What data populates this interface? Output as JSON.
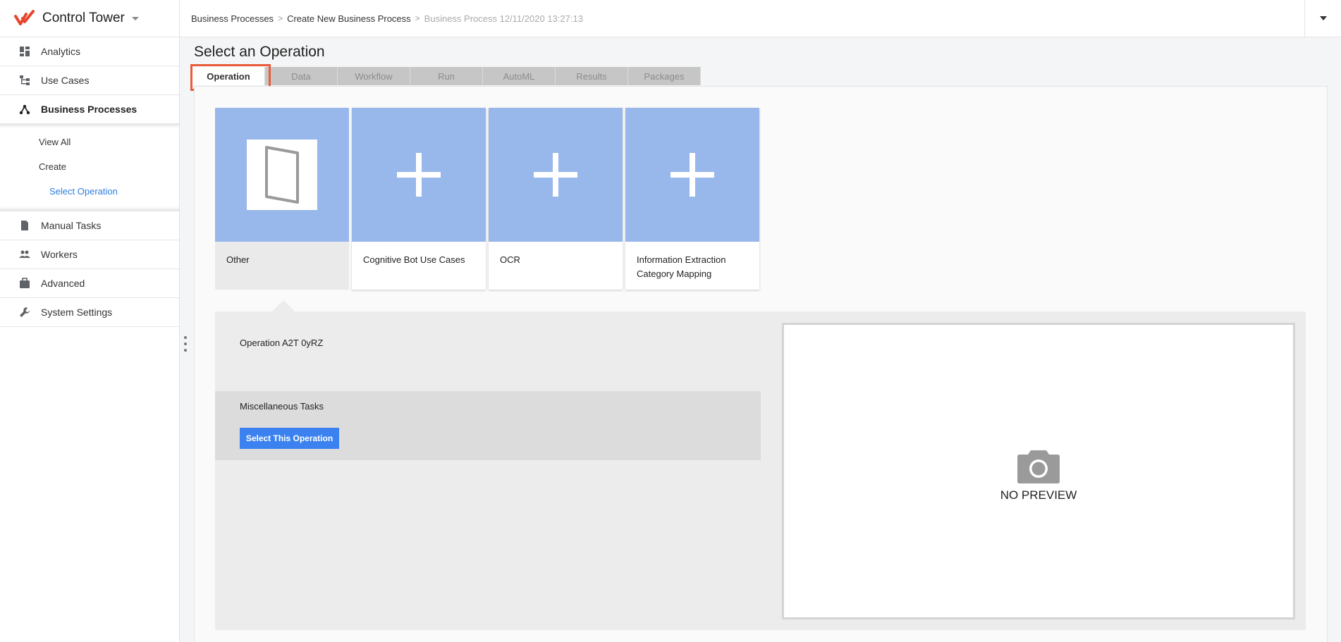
{
  "app": {
    "title": "Control Tower"
  },
  "sidebar": {
    "items": [
      {
        "label": "Analytics",
        "icon": "dashboard-icon"
      },
      {
        "label": "Use Cases",
        "icon": "hierarchy-icon"
      },
      {
        "label": "Business Processes",
        "icon": "network-icon"
      },
      {
        "label": "Manual Tasks",
        "icon": "document-icon"
      },
      {
        "label": "Workers",
        "icon": "people-icon"
      },
      {
        "label": "Advanced",
        "icon": "briefcase-icon"
      },
      {
        "label": "System Settings",
        "icon": "wrench-icon"
      }
    ],
    "subitems": {
      "view_all": "View All",
      "create": "Create",
      "select_operation": "Select Operation"
    }
  },
  "breadcrumb": {
    "items": [
      "Business Processes",
      "Create New Business Process",
      "Business Process 12/11/2020 13:27:13"
    ]
  },
  "page": {
    "title": "Select an Operation"
  },
  "tabs": [
    "Operation",
    "Data",
    "Workflow",
    "Run",
    "AutoML",
    "Results",
    "Packages"
  ],
  "cards": [
    {
      "label": "Other"
    },
    {
      "label": "Cognitive Bot Use Cases"
    },
    {
      "label": "OCR"
    },
    {
      "label": "Information Extraction Category Mapping"
    }
  ],
  "detail": {
    "operation_name": "Operation A2T 0yRZ",
    "category": "Miscellaneous Tasks",
    "select_button": "Select This Operation",
    "preview_text": "NO PREVIEW"
  },
  "colors": {
    "accent_blue": "#3b82f0",
    "card_thumb": "#98b7ea",
    "highlight": "#ea5b3a",
    "logo": "#e8452c"
  }
}
